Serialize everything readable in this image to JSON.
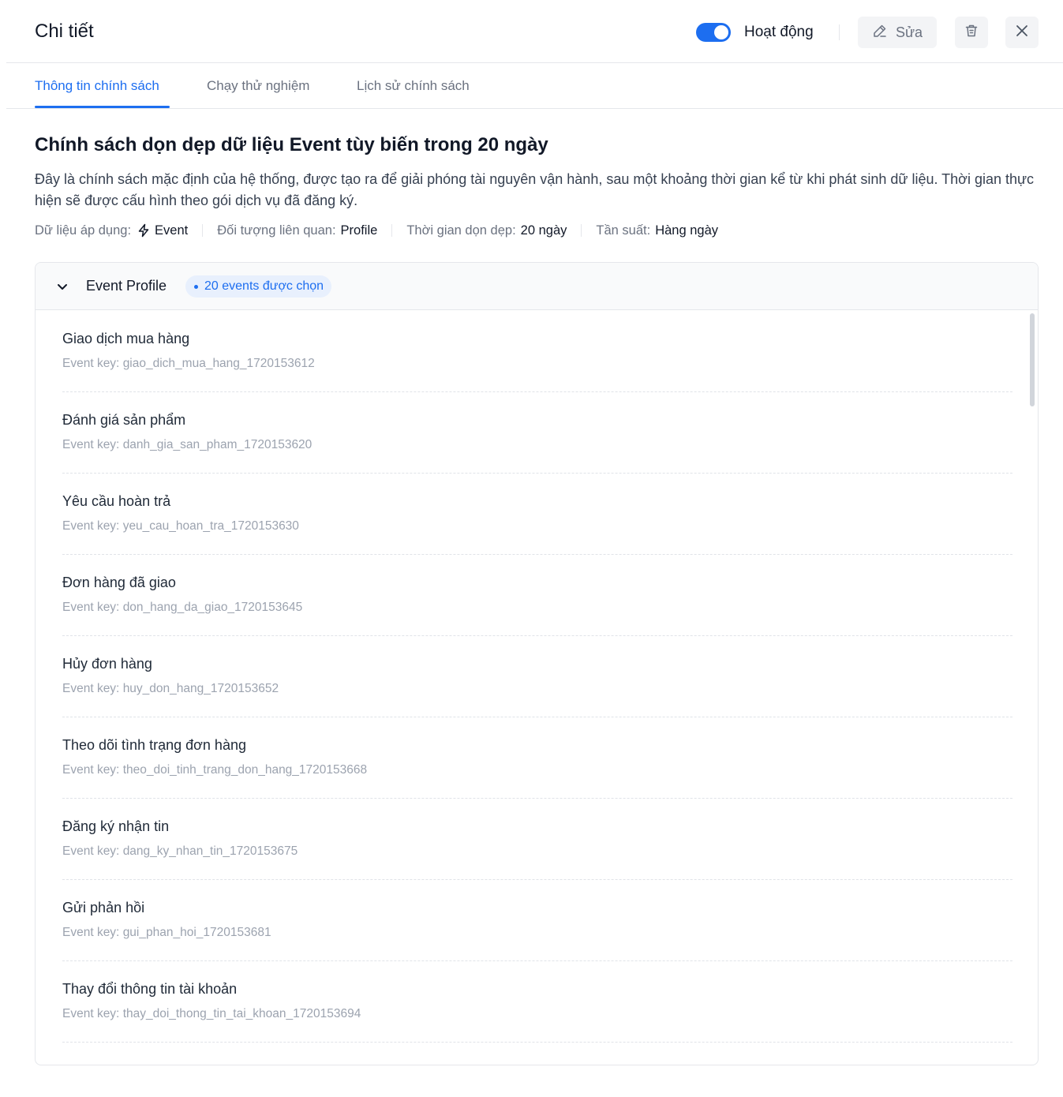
{
  "header": {
    "title": "Chi tiết",
    "status_label": "Hoạt động",
    "status_on": true,
    "edit_label": "Sửa",
    "accent_color": "#1d6ef0"
  },
  "tabs": [
    {
      "label": "Thông tin chính sách",
      "active": true
    },
    {
      "label": "Chạy thử nghiệm",
      "active": false
    },
    {
      "label": "Lịch sử chính sách",
      "active": false
    }
  ],
  "policy": {
    "title": "Chính sách dọn dẹp dữ liệu Event tùy biến trong 20 ngày",
    "description": "Đây là chính sách mặc định của hệ thống, được tạo ra để giải phóng tài nguyên vận hành, sau một khoảng thời gian kể từ khi phát sinh dữ liệu. Thời gian thực hiện sẽ được cấu hình theo gói dịch vụ đã đăng ký.",
    "meta": {
      "data_label": "Dữ liệu áp dụng:",
      "data_value": "Event",
      "object_label": "Đối tượng liên quan:",
      "object_value": "Profile",
      "cleanup_label": "Thời gian dọn dẹp:",
      "cleanup_value": "20 ngày",
      "frequency_label": "Tần suất:",
      "frequency_value": "Hàng ngày"
    }
  },
  "events_card": {
    "title": "Event Profile",
    "badge": "20 events được chọn",
    "key_prefix": "Event key:",
    "items": [
      {
        "name": "Giao dịch mua hàng",
        "key": "giao_dich_mua_hang_1720153612"
      },
      {
        "name": "Đánh giá sản phẩm",
        "key": "danh_gia_san_pham_1720153620"
      },
      {
        "name": "Yêu cầu hoàn trả",
        "key": "yeu_cau_hoan_tra_1720153630"
      },
      {
        "name": "Đơn hàng đã giao",
        "key": "don_hang_da_giao_1720153645"
      },
      {
        "name": "Hủy đơn hàng",
        "key": "huy_don_hang_1720153652"
      },
      {
        "name": "Theo dõi tình trạng đơn hàng",
        "key": "theo_doi_tinh_trang_don_hang_1720153668"
      },
      {
        "name": "Đăng ký nhận tin",
        "key": "dang_ky_nhan_tin_1720153675"
      },
      {
        "name": "Gửi phản hồi",
        "key": "gui_phan_hoi_1720153681"
      },
      {
        "name": "Thay đổi thông tin tài khoản",
        "key": "thay_doi_thong_tin_tai_khoan_1720153694"
      }
    ]
  },
  "icons": {
    "edit": "pencil-icon",
    "delete": "trash-icon",
    "close": "close-icon",
    "collapse": "chevron-down-icon",
    "event": "bolt-icon"
  }
}
